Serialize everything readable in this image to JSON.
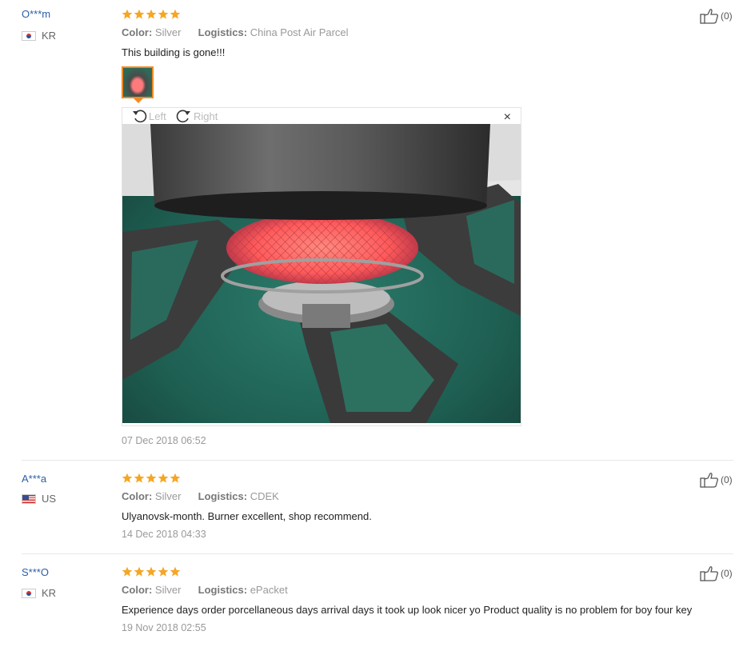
{
  "colors": {
    "star": "#f5a623",
    "username": "#2a5ea8",
    "accent": "#f08a24"
  },
  "reviews": [
    {
      "user": "O***m",
      "country": "KR",
      "flag": "korea-flag",
      "rating": 5,
      "color_label": "Color:",
      "color_value": "Silver",
      "logistics_label": "Logistics:",
      "logistics_value": "China Post Air Parcel",
      "text": "This building is gone!!!",
      "date": "07 Dec 2018 06:52",
      "helpful_count": "(0)"
    },
    {
      "user": "A***a",
      "country": "US",
      "flag": "usa-flag",
      "rating": 5,
      "color_label": "Color:",
      "color_value": "Silver",
      "logistics_label": "Logistics:",
      "logistics_value": "CDEK",
      "text": "Ulyanovsk-month. Burner excellent, shop recommend.",
      "date": "14 Dec 2018 04:33",
      "helpful_count": "(0)"
    },
    {
      "user": "S***O",
      "country": "KR",
      "flag": "korea-flag",
      "rating": 5,
      "color_label": "Color:",
      "color_value": "Silver",
      "logistics_label": "Logistics:",
      "logistics_value": "ePacket",
      "text": "Experience days order porcellaneous days arrival days it took up look nicer yo Product quality is no problem for boy four key",
      "date": "19 Nov 2018 02:55",
      "helpful_count": "(0)"
    }
  ],
  "viewer": {
    "rotate_left_label": "Left",
    "rotate_right_label": "Right",
    "close_symbol": "×"
  }
}
